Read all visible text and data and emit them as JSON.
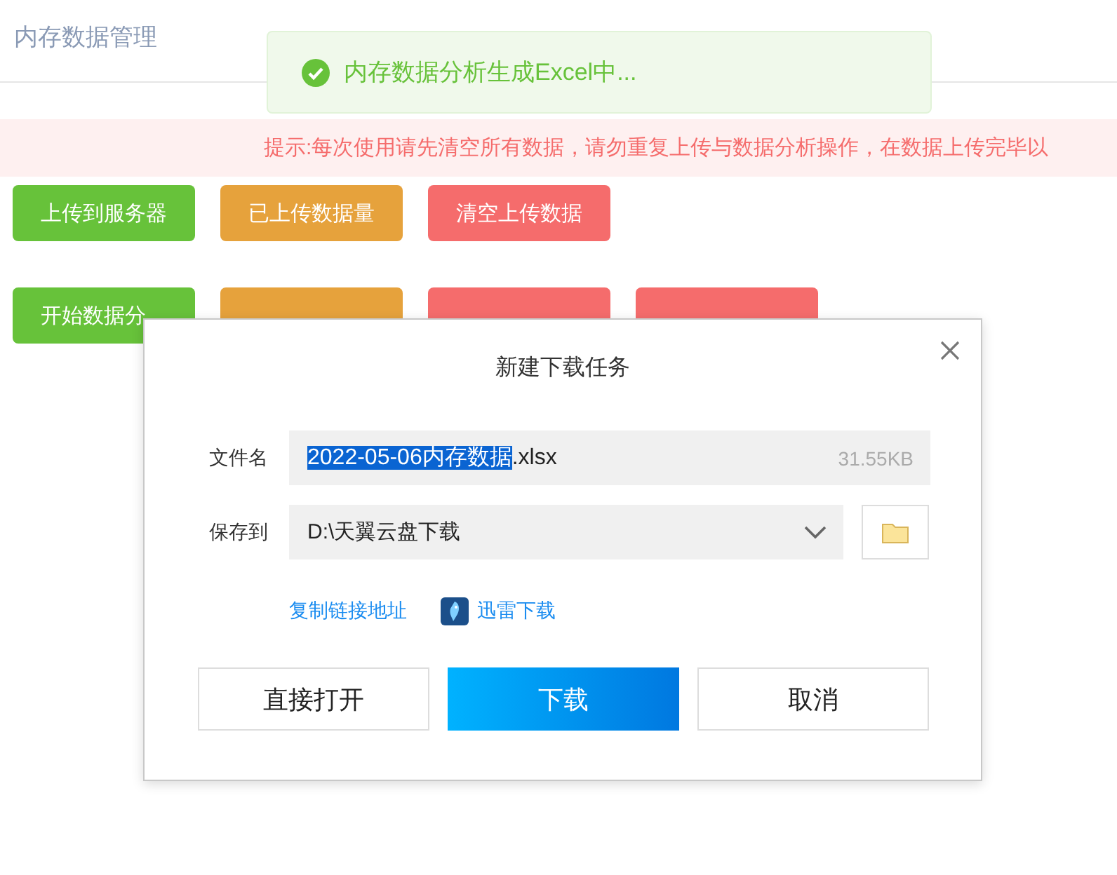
{
  "page": {
    "title": "内存数据管理"
  },
  "toast": {
    "kind": "success",
    "message": "内存数据分析生成Excel中..."
  },
  "notice": {
    "text": "提示:每次使用请先清空所有数据，请勿重复上传与数据分析操作，在数据上传完毕以"
  },
  "button_rows": [
    [
      {
        "label": "上传到服务器",
        "kind": "success"
      },
      {
        "label": "已上传数据量",
        "kind": "warning"
      },
      {
        "label": "清空上传数据",
        "kind": "danger"
      }
    ],
    [
      {
        "label": "开始数据分",
        "kind": "success"
      },
      {
        "kind": "warning"
      },
      {
        "kind": "danger"
      },
      {
        "kind": "danger"
      }
    ]
  ],
  "dialog": {
    "title": "新建下载任务",
    "file_label": "文件名",
    "file_name_selected": "2022-05-06内存数据",
    "file_name_rest": ".xlsx",
    "file_size": "31.55KB",
    "save_label": "保存到",
    "save_path": "D:\\天翼云盘下载",
    "links": [
      "复制链接地址",
      "迅雷下载"
    ],
    "buttons": [
      {
        "label": "直接打开",
        "primary": false
      },
      {
        "label": "下载",
        "primary": true
      },
      {
        "label": "取消",
        "primary": false
      }
    ]
  }
}
